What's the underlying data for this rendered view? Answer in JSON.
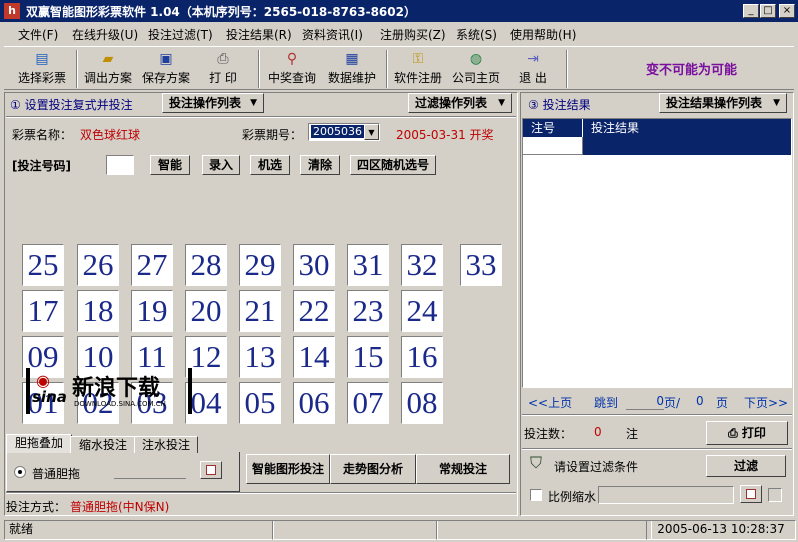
{
  "window": {
    "title": "双赢智能图形彩票软件 1.04（本机序列号：2565-018-8763-8602）",
    "min_label": "_",
    "max_label": "□",
    "close_label": "×",
    "app_icon": "h"
  },
  "menu": [
    "文件(F)",
    "在线升级(U)",
    "投注过滤(T)",
    "投注结果(R)",
    "资料资讯(I)",
    "注册购买(Z)",
    "系统(S)",
    "使用帮助(H)"
  ],
  "toolbar": {
    "items": [
      {
        "label": "选择彩票",
        "icon": "ticket-icon"
      },
      {
        "label": "调出方案",
        "icon": "open-icon"
      },
      {
        "label": "保存方案",
        "icon": "save-icon"
      },
      {
        "label": "打  印",
        "icon": "print-icon"
      },
      {
        "label": "中奖查询",
        "icon": "search-icon"
      },
      {
        "label": "数据维护",
        "icon": "database-icon"
      },
      {
        "label": "软件注册",
        "icon": "key-icon"
      },
      {
        "label": "公司主页",
        "icon": "globe-icon"
      },
      {
        "label": "退  出",
        "icon": "exit-icon"
      }
    ],
    "slogan": "变不可能为可能"
  },
  "left": {
    "section_title": "① 设置投注复式并投注",
    "betop_dropdown": "投注操作列表",
    "filterop_dropdown": "过滤操作列表",
    "lottery_label": "彩票名称：",
    "lottery_name": "双色球红球",
    "period_label": "彩票期号：",
    "period_value": "2005036",
    "period_date": "2005-03-31  开奖",
    "bet_number_label": "[投注号码]",
    "buttons": [
      "智能",
      "录入",
      "机选",
      "清除",
      "四区随机选号"
    ],
    "numbers_row1": [
      "25",
      "26",
      "27",
      "28",
      "29",
      "30",
      "31",
      "32",
      "33"
    ],
    "numbers_row2": [
      "17",
      "18",
      "19",
      "20",
      "21",
      "22",
      "23",
      "24"
    ],
    "numbers_row3": [
      "09",
      "10",
      "11",
      "12",
      "13",
      "14",
      "15",
      "16"
    ],
    "numbers_row4": [
      "01",
      "02",
      "03",
      "04",
      "05",
      "06",
      "07",
      "08"
    ],
    "watermark_main": "新浪下载",
    "watermark_brand": "sina",
    "watermark_url": "DOWNLOAD.SINA.COM.CN",
    "tabs": [
      "胆拖叠加",
      "缩水投注",
      "注水投注"
    ],
    "radio_label": "普通胆拖",
    "action_buttons": [
      "智能图形投注",
      "走势图分析",
      "常规投注"
    ],
    "bet_mode_label": "投注方式：",
    "bet_mode_value": "普通胆拖(中N保N)"
  },
  "right": {
    "section_title": "③ 投注结果",
    "result_dropdown": "投注结果操作列表",
    "table_headers": [
      "注号",
      "投注结果"
    ],
    "pager": {
      "prev": "<<上页",
      "goto": "跳到",
      "page_value": "0",
      "page_suffix": "页/",
      "total": "0",
      "total_suffix": "页",
      "next": "下页>>"
    },
    "bet_count_label": "投注数：",
    "bet_count": "0",
    "bet_count_unit": "注",
    "print_button": "打印",
    "filter_hint": "请设置过滤条件",
    "filter_button": "过滤",
    "ratio_label": "比例缩水"
  },
  "status": {
    "text": "就绪",
    "datetime": "2005-06-13  10:28:37"
  }
}
